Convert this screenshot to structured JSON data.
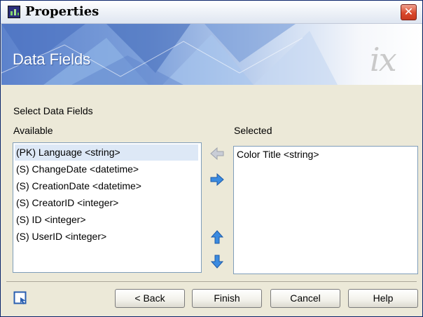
{
  "window": {
    "title": "Properties",
    "close_glyph": "✕",
    "app_icon": "chart-app-icon"
  },
  "banner": {
    "title": "Data Fields",
    "logo": "ix"
  },
  "content": {
    "section_label": "Select Data Fields",
    "available_label": "Available",
    "selected_label": "Selected",
    "available_items": [
      "(PK) Language <string>",
      "(S) ChangeDate <datetime>",
      "(S) CreationDate <datetime>",
      "(S) CreatorID <integer>",
      "(S) ID <integer>",
      "(S) UserID <integer>"
    ],
    "selected_items": [
      "Color Title <string>"
    ],
    "move_buttons": [
      "arrow-left-icon",
      "arrow-right-icon",
      "arrow-up-icon",
      "arrow-down-icon"
    ]
  },
  "footer": {
    "back_label": "< Back",
    "finish_label": "Finish",
    "cancel_label": "Cancel",
    "help_label": "Help",
    "help_icon": "context-help-icon"
  },
  "colors": {
    "dialog_bg": "#ece9d8",
    "banner_blue": "#5c82cc",
    "selection_bg": "#dde8f6",
    "close_red": "#d9482c"
  }
}
